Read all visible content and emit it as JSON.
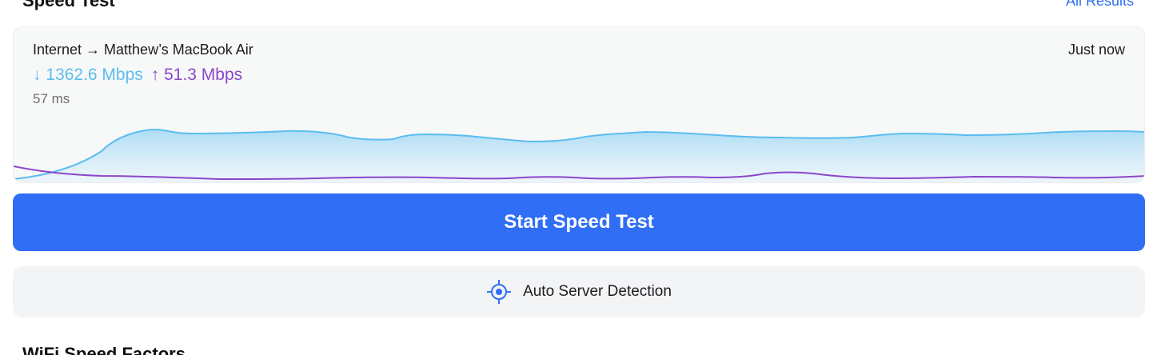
{
  "header": {
    "title": "Speed Test",
    "all_results_label": "All Results"
  },
  "result_card": {
    "route": "Internet → Matthew’s MacBook Air",
    "timestamp": "Just now",
    "download": "↓ 1362.6 Mbps",
    "upload": "↑ 51.3 Mbps",
    "latency": "57 ms"
  },
  "actions": {
    "start_label": "Start Speed Test",
    "server_label": "Auto Server Detection",
    "server_icon": "crosshair-icon"
  },
  "next_section": {
    "title": "WiFi Speed Factors"
  },
  "colors": {
    "accent": "#2f6ef5",
    "download": "#5bbdf0",
    "upload": "#8b47c9"
  }
}
